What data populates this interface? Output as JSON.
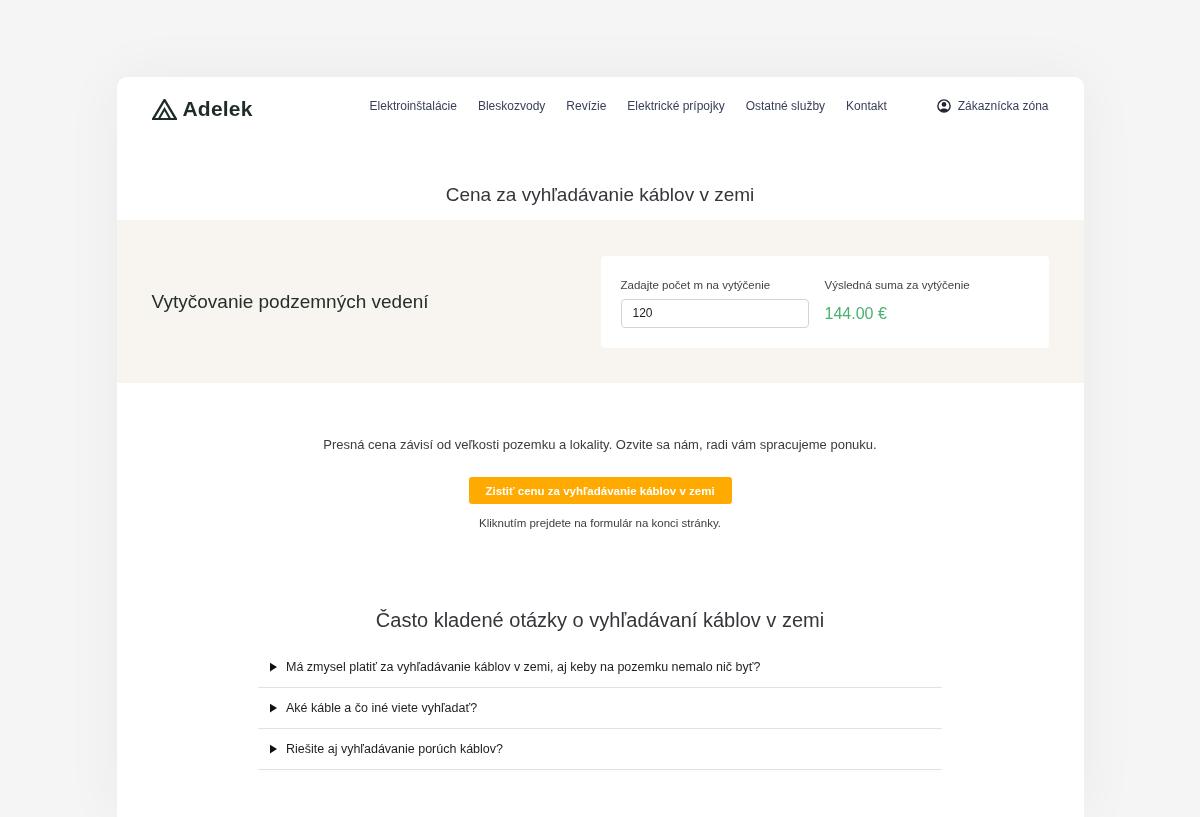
{
  "header": {
    "logo": "Adelek",
    "nav": [
      "Elektroinštalácie",
      "Bleskozvody",
      "Revízie",
      "Elektrické prípojky",
      "Ostatné služby",
      "Kontakt"
    ],
    "account_link": "Zákaznícka zóna"
  },
  "page_title": "Cena za vyhľadávanie káblov v zemi",
  "calculator": {
    "service": "Vytyčovanie podzemných vedení",
    "input_label": "Zadajte počet m na vytýčenie",
    "input_value": "120",
    "result_label": "Výsledná suma za vytýčenie",
    "result_value": "144.00 €"
  },
  "cta": {
    "text": "Presná cena závisí od veľkosti pozemku a lokality. Ozvite sa nám, radi vám spracujeme ponuku.",
    "button": "Zistiť cenu za vyhľadávanie káblov v zemi",
    "note": "Kliknutím prejdete na formulár na konci stránky."
  },
  "faq": {
    "title": "Často kladené otázky o vyhľadávaní káblov v zemi",
    "items": [
      {
        "question": "Má zmysel platiť za vyhľadávanie káblov v zemi, aj keby na pozemku nemalo nič byť?",
        "expanded": false
      },
      {
        "question": "Aké káble a čo iné viete vyhľadať?",
        "expanded": false
      },
      {
        "question": "Riešite aj vyhľadávanie porúch káblov?",
        "expanded": false
      }
    ]
  }
}
